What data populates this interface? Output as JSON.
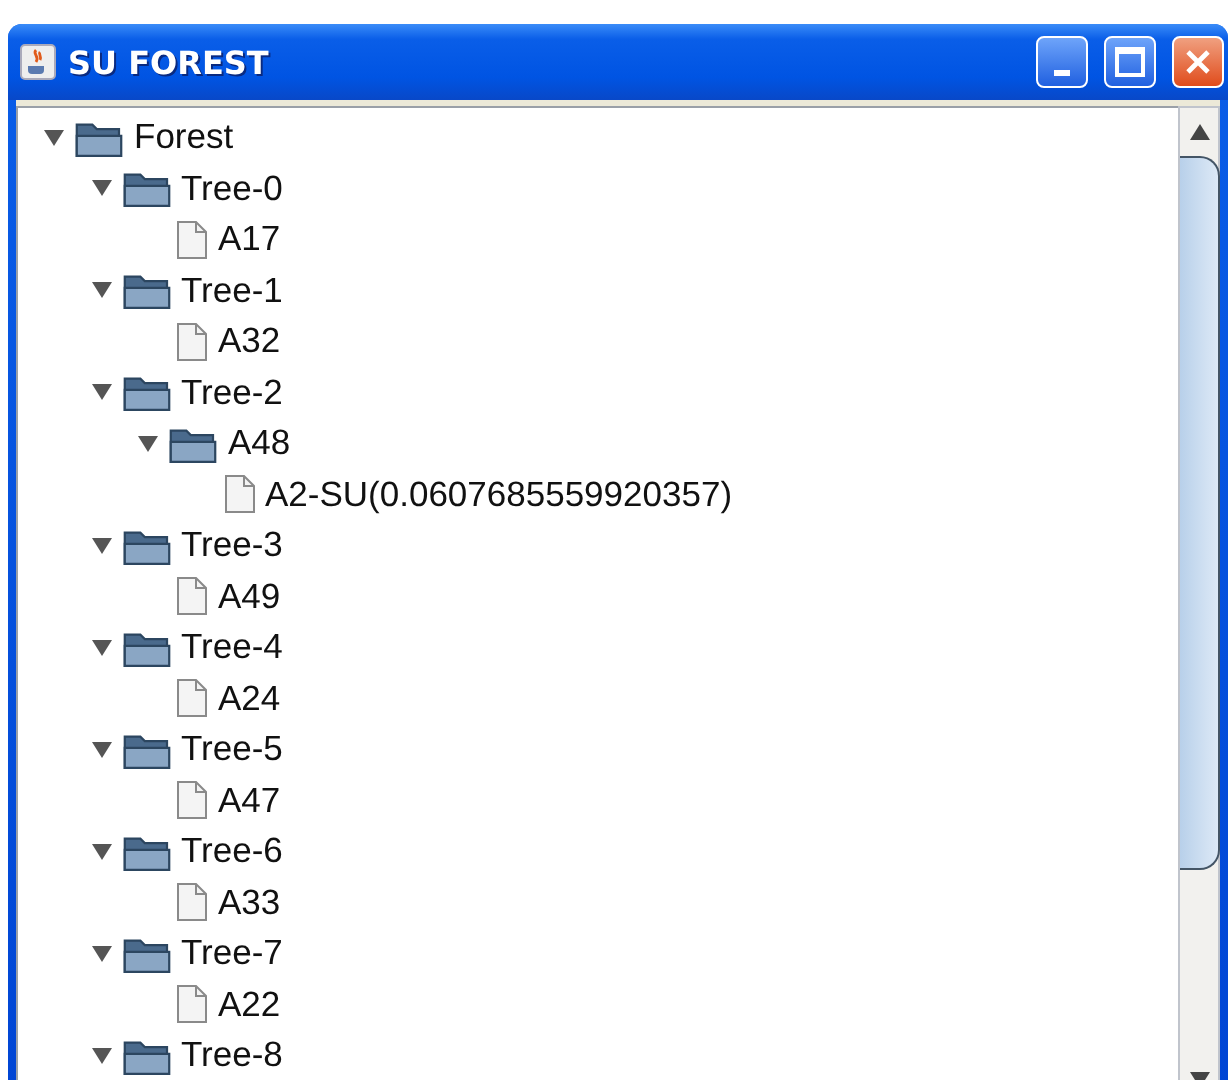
{
  "window": {
    "title": "SU FOREST"
  },
  "tree": [
    {
      "label": "Forest",
      "kind": "folder",
      "expanded": true,
      "children": [
        {
          "label": "Tree-0",
          "kind": "folder",
          "expanded": true,
          "children": [
            {
              "label": "A17",
              "kind": "leaf"
            }
          ]
        },
        {
          "label": "Tree-1",
          "kind": "folder",
          "expanded": true,
          "children": [
            {
              "label": "A32",
              "kind": "leaf"
            }
          ]
        },
        {
          "label": "Tree-2",
          "kind": "folder",
          "expanded": true,
          "children": [
            {
              "label": "A48",
              "kind": "folder",
              "expanded": true,
              "children": [
                {
                  "label": "A2-SU(0.0607685559920357)",
                  "kind": "leaf"
                }
              ]
            }
          ]
        },
        {
          "label": "Tree-3",
          "kind": "folder",
          "expanded": true,
          "children": [
            {
              "label": "A49",
              "kind": "leaf"
            }
          ]
        },
        {
          "label": "Tree-4",
          "kind": "folder",
          "expanded": true,
          "children": [
            {
              "label": "A24",
              "kind": "leaf"
            }
          ]
        },
        {
          "label": "Tree-5",
          "kind": "folder",
          "expanded": true,
          "children": [
            {
              "label": "A47",
              "kind": "leaf"
            }
          ]
        },
        {
          "label": "Tree-6",
          "kind": "folder",
          "expanded": true,
          "children": [
            {
              "label": "A33",
              "kind": "leaf"
            }
          ]
        },
        {
          "label": "Tree-7",
          "kind": "folder",
          "expanded": true,
          "children": [
            {
              "label": "A22",
              "kind": "leaf"
            }
          ]
        },
        {
          "label": "Tree-8",
          "kind": "folder",
          "expanded": true
        }
      ]
    }
  ]
}
